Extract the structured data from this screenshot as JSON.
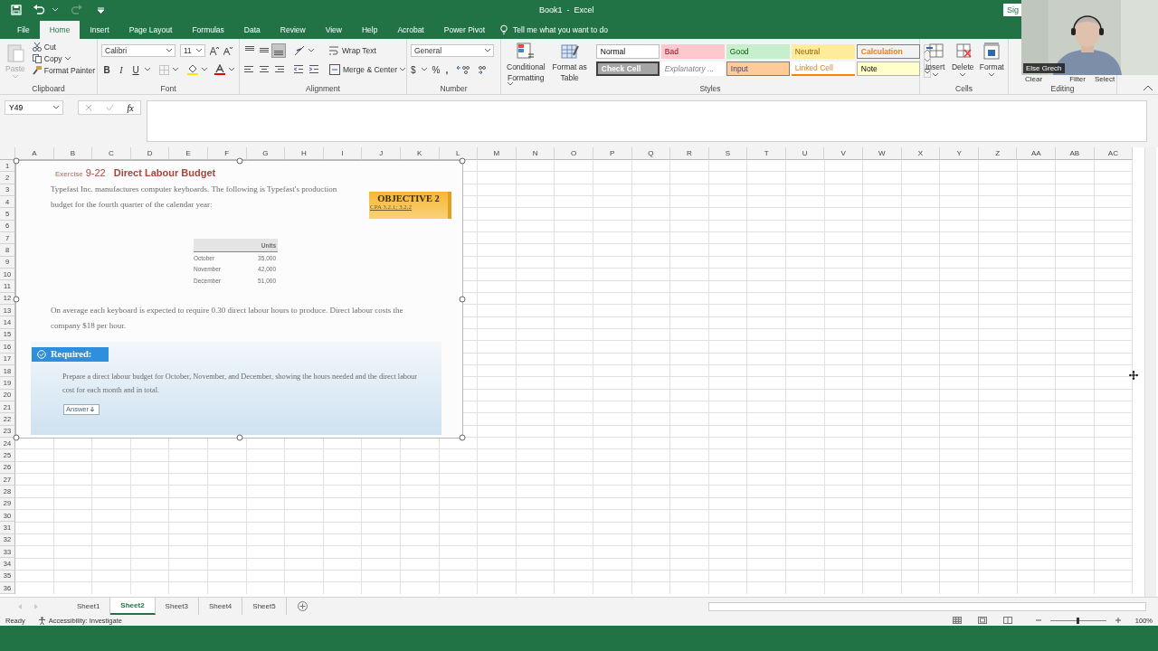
{
  "window": {
    "title": "Book1  -  Excel",
    "sign_in": "Sig"
  },
  "tabs": [
    {
      "label": "File",
      "selected": false
    },
    {
      "label": "Home",
      "selected": true
    },
    {
      "label": "Insert",
      "selected": false
    },
    {
      "label": "Page Layout",
      "selected": false
    },
    {
      "label": "Formulas",
      "selected": false
    },
    {
      "label": "Data",
      "selected": false
    },
    {
      "label": "Review",
      "selected": false
    },
    {
      "label": "View",
      "selected": false
    },
    {
      "label": "Help",
      "selected": false
    },
    {
      "label": "Acrobat",
      "selected": false
    },
    {
      "label": "Power Pivot",
      "selected": false
    }
  ],
  "tell_me": "Tell me what you want to do",
  "ribbon": {
    "clipboard": {
      "paste": "Paste",
      "paste_disabled": true,
      "cut": "Cut",
      "copy": "Copy",
      "format_painter": "Format Painter",
      "label": "Clipboard"
    },
    "font": {
      "name": "Calibri",
      "size": "11",
      "bold": "B",
      "italic": "I",
      "underline": "U",
      "label": "Font"
    },
    "alignment": {
      "vertical": [
        {
          "selected": false
        },
        {
          "selected": false
        },
        {
          "selected": true
        }
      ],
      "wrap": "Wrap Text",
      "merge": "Merge & Center",
      "label": "Alignment"
    },
    "number": {
      "format": "General",
      "currency": "$",
      "percent": "%",
      "comma": ",",
      "label": "Number"
    },
    "styles": {
      "conditional": [
        "Conditional",
        "Formatting"
      ],
      "table": [
        "Format as",
        "Table"
      ],
      "gallery": [
        {
          "label": "Normal",
          "kind": "normal"
        },
        {
          "label": "Bad",
          "kind": "bad"
        },
        {
          "label": "Good",
          "kind": "good"
        },
        {
          "label": "Neutral",
          "kind": "neutral"
        },
        {
          "label": "Calculation",
          "kind": "calculation"
        },
        {
          "label": "Check Cell",
          "kind": "check"
        },
        {
          "label": "Explanatory ...",
          "kind": "explanatory"
        },
        {
          "label": "Input",
          "kind": "input"
        },
        {
          "label": "Linked Cell",
          "kind": "linked"
        },
        {
          "label": "Note",
          "kind": "note"
        }
      ],
      "label": "Styles"
    },
    "cells": {
      "buttons": [
        "Insert",
        "Delete",
        "Format"
      ],
      "label": "Cells"
    },
    "editing": {
      "clear": "Clear",
      "filter": "Filter",
      "select": "Select",
      "label": "Editing"
    }
  },
  "formula_bar": {
    "name_box": "Y49",
    "fx": "fx"
  },
  "sheet": {
    "columns": [
      "A",
      "B",
      "C",
      "D",
      "E",
      "F",
      "G",
      "H",
      "I",
      "J",
      "K",
      "L",
      "M",
      "N",
      "O",
      "P",
      "Q",
      "R",
      "S",
      "T",
      "U",
      "V",
      "W",
      "X",
      "Y",
      "Z",
      "AA",
      "AB",
      "AC"
    ],
    "rows": [
      "1",
      "2",
      "3",
      "4",
      "5",
      "6",
      "7",
      "8",
      "9",
      "10",
      "11",
      "12",
      "13",
      "14",
      "15",
      "16",
      "17",
      "18",
      "19",
      "20",
      "21",
      "22",
      "23",
      "24",
      "25",
      "26",
      "27",
      "28",
      "29",
      "30",
      "31",
      "32",
      "33",
      "34",
      "35",
      "36"
    ]
  },
  "document": {
    "exercise": "Exercise",
    "number": "9-22",
    "title": "Direct Labour Budget",
    "intro": "Typefast Inc. manufactures computer keyboards. The following is Typefast's production budget for the fourth quarter of the calendar year:",
    "objective": "OBJECTIVE 2",
    "cpa": "CPA 3.2.1; 3.2.2",
    "table": {
      "header": "Units",
      "rows": [
        [
          "October",
          "35,000"
        ],
        [
          "November",
          "42,000"
        ],
        [
          "December",
          "51,000"
        ]
      ]
    },
    "detail": "On average each keyboard is expected to require 0.30 direct labour hours to produce. Direct labour costs the company $18 per hour.",
    "required": "Required:",
    "task": "Prepare a direct labour budget for October, November, and December, showing the hours needed and the direct labour cost for each month and in total.",
    "answer": "Answer"
  },
  "sheet_tabs": [
    {
      "label": "Sheet1",
      "selected": false
    },
    {
      "label": "Sheet2",
      "selected": true
    },
    {
      "label": "Sheet3",
      "selected": false
    },
    {
      "label": "Sheet4",
      "selected": false
    },
    {
      "label": "Sheet5",
      "selected": false
    }
  ],
  "status": {
    "ready": "Ready",
    "accessibility": "Accessibility: Investigate",
    "zoom": "100%",
    "zoom_slider": {
      "level": 0.5
    }
  },
  "webcam": {
    "name": "Else Grech"
  }
}
